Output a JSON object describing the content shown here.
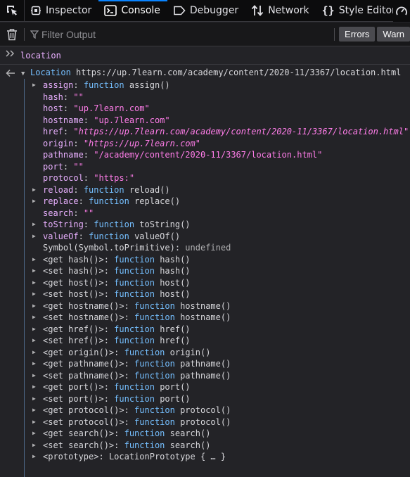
{
  "toolbar": {
    "tabs": [
      {
        "label": "Inspector",
        "icon": "inspector-icon",
        "active": false
      },
      {
        "label": "Console",
        "icon": "console-icon",
        "active": true
      },
      {
        "label": "Debugger",
        "icon": "debugger-icon",
        "active": false
      },
      {
        "label": "Network",
        "icon": "network-icon",
        "active": false
      },
      {
        "label": "Style Editor",
        "icon": "style-editor-icon",
        "active": false
      }
    ]
  },
  "filterbar": {
    "placeholder": "Filter Output",
    "errors_label": "Errors",
    "warn_label": "Warn"
  },
  "console": {
    "input": "location",
    "result": {
      "name": "Location",
      "url": "https://up.7learn.com/academy/content/2020-11/3367/location.html",
      "props": [
        {
          "key": "assign",
          "kind": "fn",
          "fname": "assign()",
          "expandable": true
        },
        {
          "key": "hash",
          "kind": "str",
          "value": "\"\""
        },
        {
          "key": "host",
          "kind": "str",
          "value": "\"up.7learn.com\""
        },
        {
          "key": "hostname",
          "kind": "str",
          "value": "\"up.7learn.com\""
        },
        {
          "key": "href",
          "kind": "stri",
          "value": "\"https://up.7learn.com/academy/content/2020-11/3367/location.html\""
        },
        {
          "key": "origin",
          "kind": "stri",
          "value": "\"https://up.7learn.com\""
        },
        {
          "key": "pathname",
          "kind": "str",
          "value": "\"/academy/content/2020-11/3367/location.html\""
        },
        {
          "key": "port",
          "kind": "str",
          "value": "\"\""
        },
        {
          "key": "protocol",
          "kind": "str",
          "value": "\"https:\""
        },
        {
          "key": "reload",
          "kind": "fn",
          "fname": "reload()",
          "expandable": true
        },
        {
          "key": "replace",
          "kind": "fn",
          "fname": "replace()",
          "expandable": true
        },
        {
          "key": "search",
          "kind": "str",
          "value": "\"\""
        },
        {
          "key": "toString",
          "kind": "fn",
          "fname": "toString()",
          "expandable": true
        },
        {
          "key": "valueOf",
          "kind": "fn",
          "fname": "valueOf()",
          "expandable": true
        },
        {
          "key": "Symbol(Symbol.toPrimitive)",
          "kind": "undef",
          "value": "undefined"
        },
        {
          "key": "<get hash()>",
          "kind": "gs",
          "fname": "hash()",
          "expandable": true
        },
        {
          "key": "<set hash()>",
          "kind": "gs",
          "fname": "hash()",
          "expandable": true
        },
        {
          "key": "<get host()>",
          "kind": "gs",
          "fname": "host()",
          "expandable": true
        },
        {
          "key": "<set host()>",
          "kind": "gs",
          "fname": "host()",
          "expandable": true
        },
        {
          "key": "<get hostname()>",
          "kind": "gs",
          "fname": "hostname()",
          "expandable": true
        },
        {
          "key": "<set hostname()>",
          "kind": "gs",
          "fname": "hostname()",
          "expandable": true
        },
        {
          "key": "<get href()>",
          "kind": "gs",
          "fname": "href()",
          "expandable": true
        },
        {
          "key": "<set href()>",
          "kind": "gs",
          "fname": "href()",
          "expandable": true
        },
        {
          "key": "<get origin()>",
          "kind": "gs",
          "fname": "origin()",
          "expandable": true
        },
        {
          "key": "<get pathname()>",
          "kind": "gs",
          "fname": "pathname()",
          "expandable": true
        },
        {
          "key": "<set pathname()>",
          "kind": "gs",
          "fname": "pathname()",
          "expandable": true
        },
        {
          "key": "<get port()>",
          "kind": "gs",
          "fname": "port()",
          "expandable": true
        },
        {
          "key": "<set port()>",
          "kind": "gs",
          "fname": "port()",
          "expandable": true
        },
        {
          "key": "<get protocol()>",
          "kind": "gs",
          "fname": "protocol()",
          "expandable": true
        },
        {
          "key": "<set protocol()>",
          "kind": "gs",
          "fname": "protocol()",
          "expandable": true
        },
        {
          "key": "<get search()>",
          "kind": "gs",
          "fname": "search()",
          "expandable": true
        },
        {
          "key": "<set search()>",
          "kind": "gs",
          "fname": "search()",
          "expandable": true
        },
        {
          "key": "<prototype>",
          "kind": "proto",
          "value": "LocationPrototype { … }",
          "expandable": true
        }
      ]
    }
  },
  "labels": {
    "function_keyword": "function",
    "undefined_text": "undefined"
  },
  "colors": {
    "accent": "#0a84ff",
    "background": "#232327",
    "key": "#e9b0ff",
    "string": "#ff7de9",
    "function": "#75bfff"
  }
}
